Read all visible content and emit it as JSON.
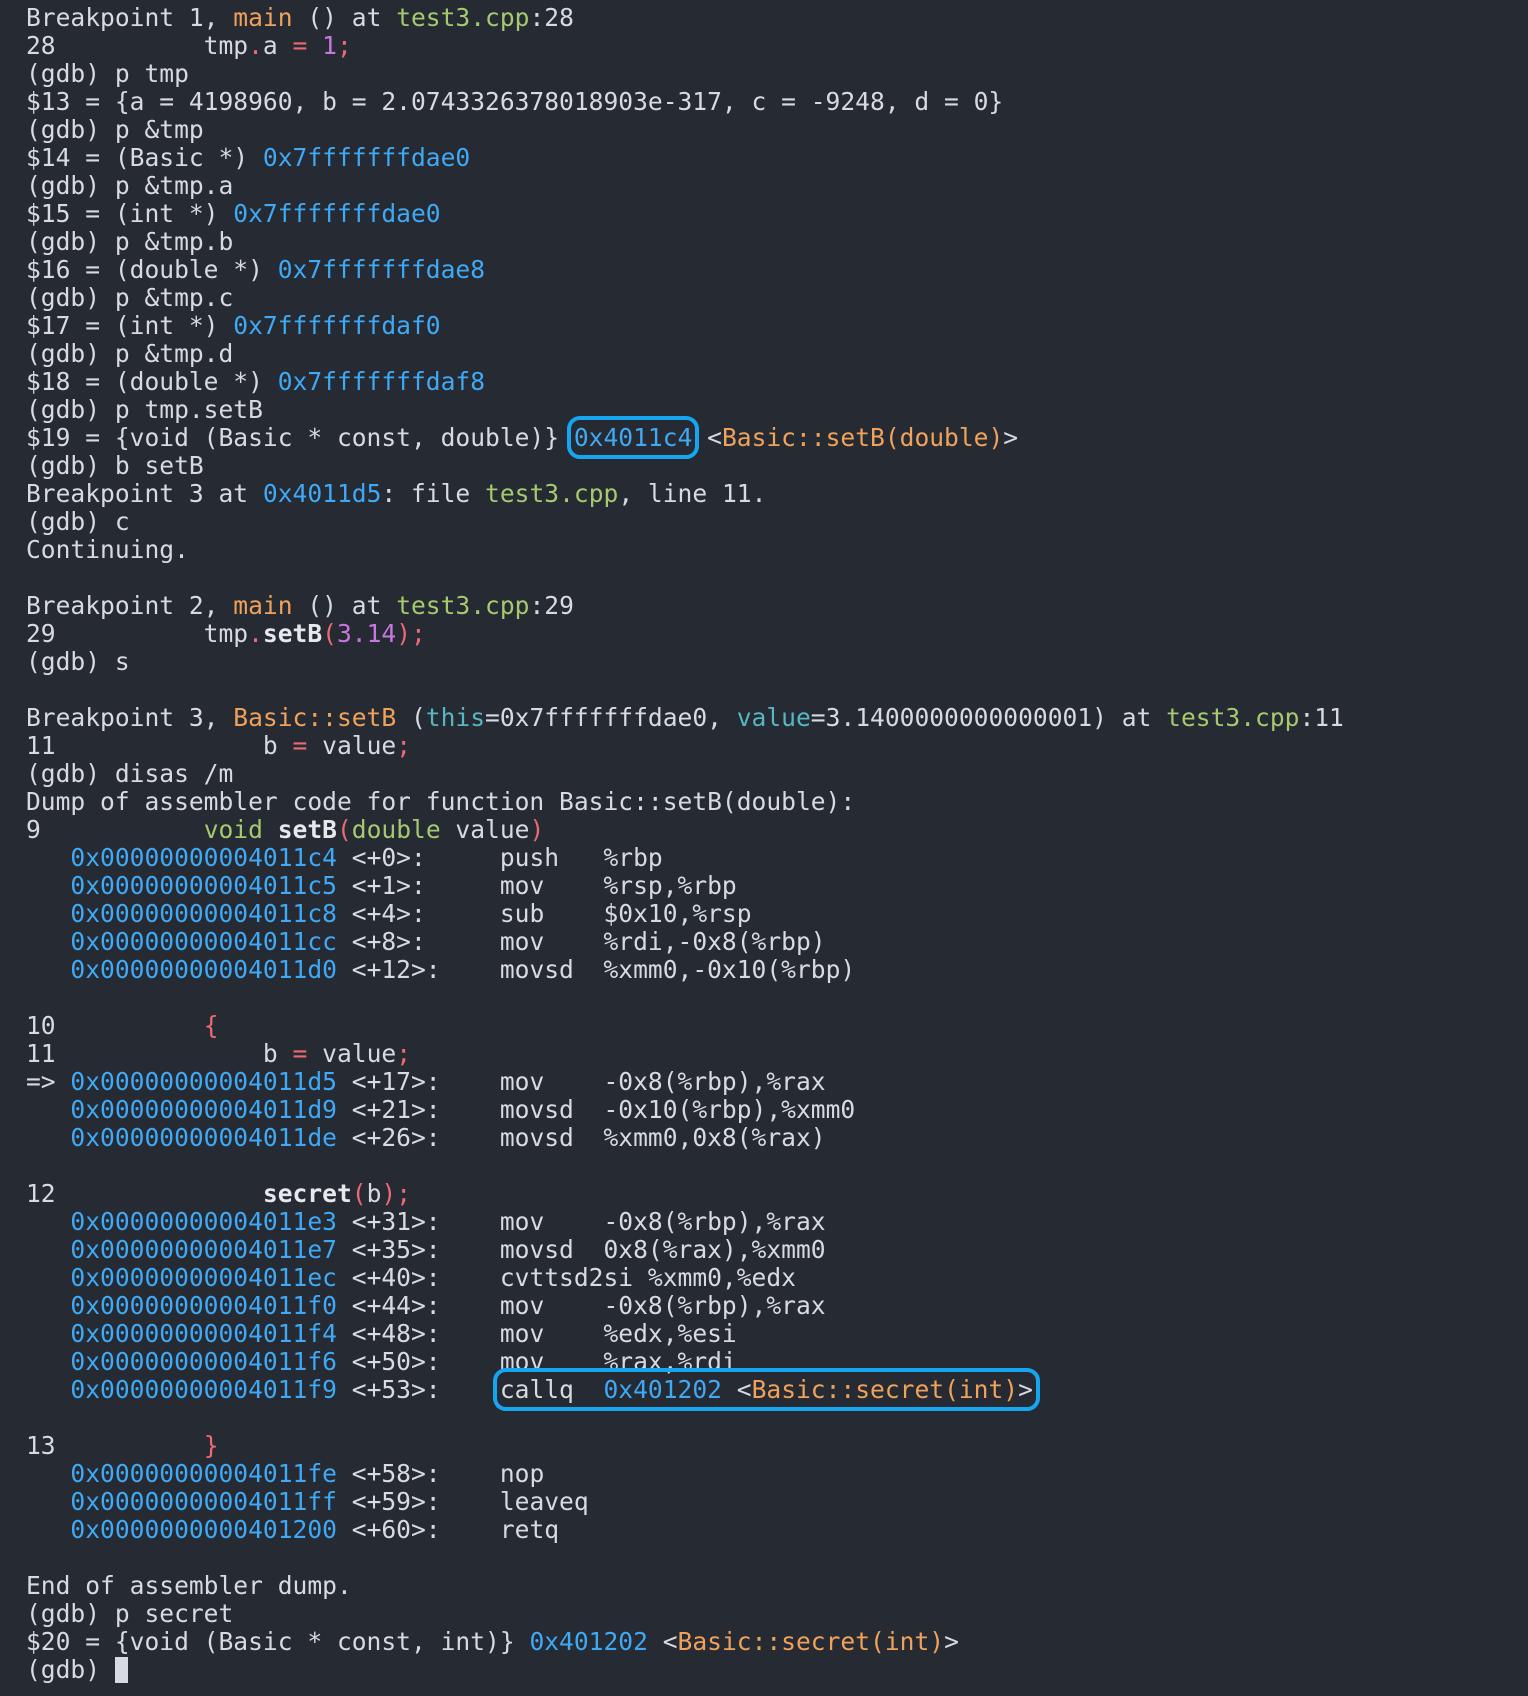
{
  "terminal": {
    "lines": [
      [
        [
          "Breakpoint 1, ",
          "default"
        ],
        [
          "main",
          "func"
        ],
        [
          " () at ",
          "default"
        ],
        [
          "test3.cpp",
          "file"
        ],
        [
          ":28",
          "default"
        ]
      ],
      [
        [
          "28          tmp",
          "default"
        ],
        [
          ".",
          "red"
        ],
        [
          "a ",
          "default"
        ],
        [
          "=",
          "red"
        ],
        [
          " ",
          "default"
        ],
        [
          "1",
          "num"
        ],
        [
          ";",
          "red"
        ]
      ],
      [
        [
          "(gdb) p tmp",
          "default"
        ]
      ],
      [
        [
          "$13 = {a = 4198960, b = 2.0743326378018903e-317, c = -9248, d = 0}",
          "default"
        ]
      ],
      [
        [
          "(gdb) p &tmp",
          "default"
        ]
      ],
      [
        [
          "$14 = (Basic *) ",
          "default"
        ],
        [
          "0x7fffffffdae0",
          "addr"
        ]
      ],
      [
        [
          "(gdb) p &tmp.a",
          "default"
        ]
      ],
      [
        [
          "$15 = (int *) ",
          "default"
        ],
        [
          "0x7fffffffdae0",
          "addr"
        ]
      ],
      [
        [
          "(gdb) p &tmp.b",
          "default"
        ]
      ],
      [
        [
          "$16 = (double *) ",
          "default"
        ],
        [
          "0x7fffffffdae8",
          "addr"
        ]
      ],
      [
        [
          "(gdb) p &tmp.c",
          "default"
        ]
      ],
      [
        [
          "$17 = (int *) ",
          "default"
        ],
        [
          "0x7fffffffdaf0",
          "addr"
        ]
      ],
      [
        [
          "(gdb) p &tmp.d",
          "default"
        ]
      ],
      [
        [
          "$18 = (double *) ",
          "default"
        ],
        [
          "0x7fffffffdaf8",
          "addr"
        ]
      ],
      [
        [
          "(gdb) p tmp.setB",
          "default"
        ]
      ],
      [
        [
          "$19 = {void (Basic * const, double)} ",
          "default"
        ],
        [
          "0x4011c4",
          "addr",
          "box"
        ],
        [
          " <",
          "default"
        ],
        [
          "Basic::setB(double)",
          "func"
        ],
        [
          ">",
          "default"
        ]
      ],
      [
        [
          "(gdb) b setB",
          "default"
        ]
      ],
      [
        [
          "Breakpoint 3 at ",
          "default"
        ],
        [
          "0x4011d5",
          "addr"
        ],
        [
          ": file ",
          "default"
        ],
        [
          "test3.cpp",
          "file"
        ],
        [
          ", line 11.",
          "default"
        ]
      ],
      [
        [
          "(gdb) c",
          "default"
        ]
      ],
      [
        [
          "Continuing.",
          "default"
        ]
      ],
      [],
      [
        [
          "Breakpoint 2, ",
          "default"
        ],
        [
          "main",
          "func"
        ],
        [
          " () at ",
          "default"
        ],
        [
          "test3.cpp",
          "file"
        ],
        [
          ":29",
          "default"
        ]
      ],
      [
        [
          "29          tmp",
          "default"
        ],
        [
          ".",
          "red"
        ],
        [
          "setB",
          "bold"
        ],
        [
          "(",
          "red"
        ],
        [
          "3.14",
          "num"
        ],
        [
          ");",
          "red"
        ]
      ],
      [
        [
          "(gdb) s",
          "default"
        ]
      ],
      [],
      [
        [
          "Breakpoint 3, ",
          "default"
        ],
        [
          "Basic::setB",
          "func"
        ],
        [
          " (",
          "default"
        ],
        [
          "this",
          "param"
        ],
        [
          "=0x7fffffffdae0, ",
          "default"
        ],
        [
          "value",
          "param"
        ],
        [
          "=3.1400000000000001) at ",
          "default"
        ],
        [
          "test3.cpp",
          "file"
        ],
        [
          ":11",
          "default"
        ]
      ],
      [
        [
          "11              b ",
          "default"
        ],
        [
          "=",
          "red"
        ],
        [
          " value",
          "default"
        ],
        [
          ";",
          "red"
        ]
      ],
      [
        [
          "(gdb) disas /m",
          "default"
        ]
      ],
      [
        [
          "Dump of assembler code for function Basic::setB(double):",
          "default"
        ]
      ],
      [
        [
          "9           ",
          "default"
        ],
        [
          "void",
          "kw"
        ],
        [
          " ",
          "default"
        ],
        [
          "setB",
          "bold"
        ],
        [
          "(",
          "red"
        ],
        [
          "double",
          "kw"
        ],
        [
          " value",
          "default"
        ],
        [
          ")",
          "red"
        ]
      ],
      [
        [
          "   ",
          "default"
        ],
        [
          "0x00000000004011c4",
          "addr"
        ],
        [
          " <+0>:     push   %rbp",
          "default"
        ]
      ],
      [
        [
          "   ",
          "default"
        ],
        [
          "0x00000000004011c5",
          "addr"
        ],
        [
          " <+1>:     mov    %rsp,%rbp",
          "default"
        ]
      ],
      [
        [
          "   ",
          "default"
        ],
        [
          "0x00000000004011c8",
          "addr"
        ],
        [
          " <+4>:     sub    $0x10,%rsp",
          "default"
        ]
      ],
      [
        [
          "   ",
          "default"
        ],
        [
          "0x00000000004011cc",
          "addr"
        ],
        [
          " <+8>:     mov    %rdi,-0x8(%rbp)",
          "default"
        ]
      ],
      [
        [
          "   ",
          "default"
        ],
        [
          "0x00000000004011d0",
          "addr"
        ],
        [
          " <+12>:    movsd  %xmm0,-0x10(%rbp)",
          "default"
        ]
      ],
      [],
      [
        [
          "10          ",
          "default"
        ],
        [
          "{",
          "red"
        ]
      ],
      [
        [
          "11              b ",
          "default"
        ],
        [
          "=",
          "red"
        ],
        [
          " value",
          "default"
        ],
        [
          ";",
          "red"
        ]
      ],
      [
        [
          "=> ",
          "default"
        ],
        [
          "0x00000000004011d5",
          "addr"
        ],
        [
          " <+17>:    mov    -0x8(%rbp),%rax",
          "default"
        ]
      ],
      [
        [
          "   ",
          "default"
        ],
        [
          "0x00000000004011d9",
          "addr"
        ],
        [
          " <+21>:    movsd  -0x10(%rbp),%xmm0",
          "default"
        ]
      ],
      [
        [
          "   ",
          "default"
        ],
        [
          "0x00000000004011de",
          "addr"
        ],
        [
          " <+26>:    movsd  %xmm0,0x8(%rax)",
          "default"
        ]
      ],
      [],
      [
        [
          "12              ",
          "default"
        ],
        [
          "secret",
          "bold"
        ],
        [
          "(",
          "red"
        ],
        [
          "b",
          "default"
        ],
        [
          ");",
          "red"
        ]
      ],
      [
        [
          "   ",
          "default"
        ],
        [
          "0x00000000004011e3",
          "addr"
        ],
        [
          " <+31>:    mov    -0x8(%rbp),%rax",
          "default"
        ]
      ],
      [
        [
          "   ",
          "default"
        ],
        [
          "0x00000000004011e7",
          "addr"
        ],
        [
          " <+35>:    movsd  0x8(%rax),%xmm0",
          "default"
        ]
      ],
      [
        [
          "   ",
          "default"
        ],
        [
          "0x00000000004011ec",
          "addr"
        ],
        [
          " <+40>:    cvttsd2si %xmm0,%edx",
          "default"
        ]
      ],
      [
        [
          "   ",
          "default"
        ],
        [
          "0x00000000004011f0",
          "addr"
        ],
        [
          " <+44>:    mov    -0x8(%rbp),%rax",
          "default"
        ]
      ],
      [
        [
          "   ",
          "default"
        ],
        [
          "0x00000000004011f4",
          "addr"
        ],
        [
          " <+48>:    mov    %edx,%esi",
          "default"
        ]
      ],
      [
        [
          "   ",
          "default"
        ],
        [
          "0x00000000004011f6",
          "addr"
        ],
        [
          " <+50>:    mov    %rax,%rdi",
          "default"
        ]
      ],
      [
        [
          "   ",
          "default"
        ],
        [
          "0x00000000004011f9",
          "addr"
        ],
        [
          " <+53>:    ",
          "default"
        ],
        [
          "callq  0x401202 <Basic::secret(int)>",
          "callbox",
          "box"
        ]
      ],
      [],
      [
        [
          "13          ",
          "default"
        ],
        [
          "}",
          "red"
        ]
      ],
      [
        [
          "   ",
          "default"
        ],
        [
          "0x00000000004011fe",
          "addr"
        ],
        [
          " <+58>:    nop",
          "default"
        ]
      ],
      [
        [
          "   ",
          "default"
        ],
        [
          "0x00000000004011ff",
          "addr"
        ],
        [
          " <+59>:    leaveq",
          "default"
        ]
      ],
      [
        [
          "   ",
          "default"
        ],
        [
          "0x0000000000401200",
          "addr"
        ],
        [
          " <+60>:    retq",
          "default"
        ]
      ],
      [],
      [
        [
          "End of assembler dump.",
          "default"
        ]
      ],
      [
        [
          "(gdb) p secret",
          "default"
        ]
      ],
      [
        [
          "$20 = {void (Basic * const, int)} ",
          "default"
        ],
        [
          "0x401202",
          "addr"
        ],
        [
          " <",
          "default"
        ],
        [
          "Basic::secret(int)",
          "func"
        ],
        [
          ">",
          "default"
        ]
      ],
      [
        [
          "(gdb) ",
          "default"
        ],
        [
          "",
          "cursor"
        ]
      ]
    ]
  },
  "colors": {
    "background": "#262a33",
    "text": "#d7dae0",
    "address": "#3fa9f5",
    "function": "#f0a25a",
    "file": "#a4c96e",
    "number": "#c678dd",
    "punctuation": "#ec6a72",
    "highlight_box": "#16a6f0"
  }
}
